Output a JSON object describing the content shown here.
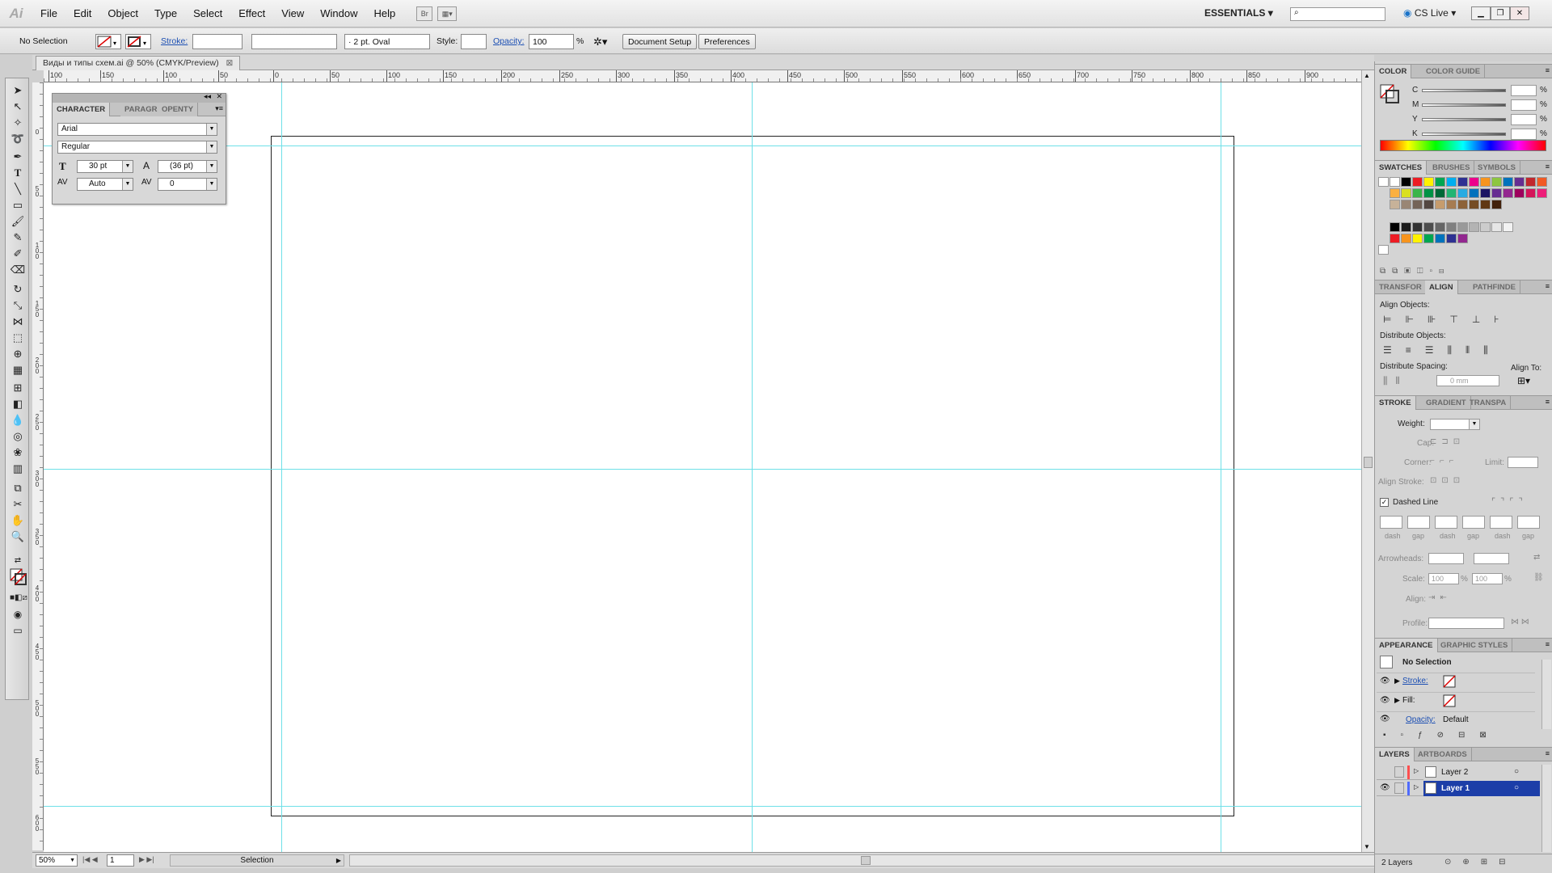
{
  "app": {
    "logo": "Ai"
  },
  "menu": [
    "File",
    "Edit",
    "Object",
    "Type",
    "Select",
    "Effect",
    "View",
    "Window",
    "Help"
  ],
  "menubar_right": {
    "workspace": "ESSENTIALS",
    "cslive": "CS Live"
  },
  "control_bar": {
    "selection": "No Selection",
    "stroke_label": "Stroke:",
    "brush": "2 pt. Oval",
    "style_label": "Style:",
    "opacity_label": "Opacity:",
    "opacity_value": "100",
    "opacity_unit": "%",
    "document_setup": "Document Setup",
    "preferences": "Preferences"
  },
  "document": {
    "tab_title": "Виды и типы схем.ai @ 50% (CMYK/Preview)"
  },
  "rulers": {
    "h_ticks": [
      "100",
      "150",
      "100",
      "50",
      "0",
      "50",
      "100",
      "150",
      "200",
      "250",
      "300",
      "350",
      "400",
      "450",
      "500",
      "550",
      "600",
      "650",
      "700",
      "750",
      "800",
      "850",
      "900"
    ],
    "v_ticks": [
      "0",
      "50",
      "100",
      "150",
      "200",
      "250",
      "300",
      "350",
      "400",
      "450",
      "500",
      "550",
      "600"
    ]
  },
  "status_bar": {
    "zoom": "50%",
    "page": "1",
    "tool": "Selection"
  },
  "character_panel": {
    "tabs": [
      "CHARACTER",
      "PARAGR",
      "OPENTY"
    ],
    "font_family": "Arial",
    "font_style": "Regular",
    "font_size": "30 pt",
    "leading": "(36 pt)",
    "kerning": "Auto",
    "tracking": "0"
  },
  "color_panel": {
    "tabs": [
      "COLOR",
      "COLOR GUIDE"
    ],
    "channels": [
      "C",
      "M",
      "Y",
      "K"
    ],
    "unit": "%"
  },
  "swatches_panel": {
    "tabs": [
      "SWATCHES",
      "BRUSHES",
      "SYMBOLS"
    ],
    "colors": [
      "#ffffff",
      "#000000",
      "#ed1c24",
      "#fff200",
      "#00a651",
      "#00aeef",
      "#2e3192",
      "#ec008c",
      "#f7941d",
      "#8dc63f",
      "#0072bc",
      "#662d91",
      "#c1272d",
      "#f15a24",
      "#fbb040",
      "#d9e021",
      "#39b54a",
      "#009245",
      "#006837",
      "#22b573",
      "#29abe2",
      "#0071bc",
      "#1b1464",
      "#662d91",
      "#93278f",
      "#9e005d",
      "#d4145a",
      "#ed1e79",
      "#c7b299",
      "#998675",
      "#736357",
      "#534741",
      "#c69c6d",
      "#a67c52",
      "#8c6239",
      "#754c24",
      "#603813",
      "#42210b"
    ],
    "grays": [
      "#000000",
      "#1a1a1a",
      "#333333",
      "#4d4d4d",
      "#666666",
      "#808080",
      "#999999",
      "#b3b3b3",
      "#cccccc",
      "#e6e6e6",
      "#f2f2f2"
    ],
    "bright": [
      "#ed1c24",
      "#f7941d",
      "#fff200",
      "#00a651",
      "#0072bc",
      "#2e3192",
      "#92278f"
    ]
  },
  "align_panel": {
    "tabs": [
      "TRANSFOR",
      "ALIGN",
      "PATHFINDE"
    ],
    "align_objects": "Align Objects:",
    "distribute_objects": "Distribute Objects:",
    "distribute_spacing": "Distribute Spacing:",
    "align_to": "Align To:",
    "spacing_value": "0 mm"
  },
  "stroke_panel": {
    "tabs": [
      "STROKE",
      "GRADIENT",
      "TRANSPA"
    ],
    "weight": "Weight:",
    "cap": "Cap:",
    "corner": "Corner:",
    "limit": "Limit:",
    "align_stroke": "Align Stroke:",
    "dashed_line": "Dashed Line",
    "dash_labels": [
      "dash",
      "gap",
      "dash",
      "gap",
      "dash",
      "gap"
    ],
    "arrowheads": "Arrowheads:",
    "scale": "Scale:",
    "scale_value_1": "100",
    "scale_value_2": "100",
    "scale_unit": "%",
    "align": "Align:",
    "profile": "Profile:"
  },
  "appearance_panel": {
    "tabs": [
      "APPEARANCE",
      "GRAPHIC STYLES"
    ],
    "selection": "No Selection",
    "stroke": "Stroke:",
    "fill": "Fill:",
    "opacity": "Opacity:",
    "opacity_value": "Default"
  },
  "layers_panel": {
    "tabs": [
      "LAYERS",
      "ARTBOARDS"
    ],
    "layers": [
      {
        "name": "Layer 2",
        "selected": false,
        "color": "#ff4f4f"
      },
      {
        "name": "Layer 1",
        "selected": true,
        "color": "#4f6bff"
      }
    ],
    "count": "2 Layers"
  }
}
